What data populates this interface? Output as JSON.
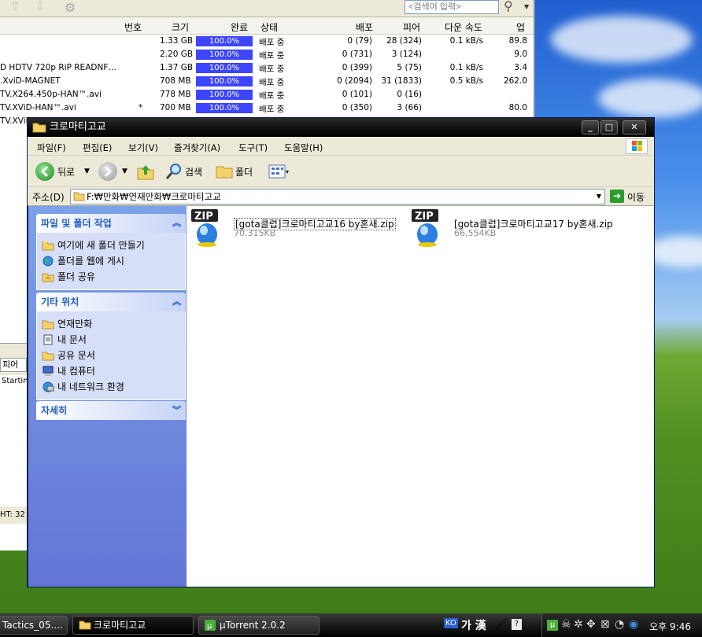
{
  "utorrent": {
    "search_placeholder": "<검색어 입력>",
    "columns": [
      "번호",
      "크기",
      "완료",
      "상태",
      "배포",
      "피어",
      "다운 속도",
      "업"
    ],
    "rows": [
      {
        "name": "",
        "num": "",
        "size": "1.33 GB",
        "done": "100.0%",
        "status": "배포 중",
        "seeds": "0 (79)",
        "peers": "28 (324)",
        "down": "0.1 kB/s",
        "up": "89.8"
      },
      {
        "name": "",
        "num": "",
        "size": "2.20 GB",
        "done": "100.0%",
        "status": "배포 중",
        "seeds": "0 (731)",
        "peers": "3 (124)",
        "down": "",
        "up": "9.0"
      },
      {
        "name": "D HDTV 720p RiP READNF…",
        "num": "",
        "size": "1.37 GB",
        "done": "100.0%",
        "status": "배포 중",
        "seeds": "0 (399)",
        "peers": "5 (75)",
        "down": "0.1 kB/s",
        "up": "3.4"
      },
      {
        "name": ".XviD-MAGNET",
        "num": "",
        "size": "708 MB",
        "done": "100.0%",
        "status": "배포 중",
        "seeds": "0 (2094)",
        "peers": "31 (1833)",
        "down": "0.5 kB/s",
        "up": "262.0"
      },
      {
        "name": "TV.X264.450p-HAN™.avi",
        "num": "",
        "size": "778 MB",
        "done": "100.0%",
        "status": "배포 중",
        "seeds": "0 (101)",
        "peers": "0 (16)",
        "down": "",
        "up": ""
      },
      {
        "name": "TV.XViD-HAN™.avi",
        "num": "*",
        "size": "700 MB",
        "done": "100.0%",
        "status": "배포 중",
        "seeds": "0 (350)",
        "peers": "3 (66)",
        "down": "",
        "up": "80.0"
      },
      {
        "name": "TV.XViD",
        "num": "",
        "size": "",
        "done": "",
        "status": "",
        "seeds": "",
        "peers": "",
        "down": "",
        "up": ""
      }
    ],
    "lower_tab": "피어",
    "log_text": "Startin",
    "status_text": "HT: 32"
  },
  "explorer": {
    "title": "크로마티고교",
    "menu": [
      "파일(F)",
      "편집(E)",
      "보기(V)",
      "즐겨찾기(A)",
      "도구(T)",
      "도움말(H)"
    ],
    "toolbar": {
      "back": "뒤로",
      "search": "검색",
      "folders": "폴더"
    },
    "address": {
      "label": "주소(D)",
      "path": "F:₩만화₩연재만화₩크로마티고교",
      "go": "이동"
    },
    "tasks": {
      "title": "파일 및 폴더 작업",
      "items": [
        "여기에 새 폴더 만들기",
        "폴더를 웹에 게시",
        "폴더 공유"
      ]
    },
    "places": {
      "title": "기타 위치",
      "items": [
        "연재만화",
        "내 문서",
        "공유 문서",
        "내 컴퓨터",
        "내 네트워크 환경"
      ]
    },
    "details": {
      "title": "자세히"
    },
    "files": [
      {
        "name": "[gota클럽]크로마티고교16 by혼새.zip",
        "size": "70,315KB"
      },
      {
        "name": "[gota클럽]크로마티고교17 by혼새.zip",
        "size": "66,554KB"
      }
    ]
  },
  "taskbar": {
    "buttons": [
      "Tactics_05....",
      "크로마티고교",
      "µTorrent 2.0.2"
    ],
    "ime_label": "가 漢",
    "clock": "오후 9:46"
  },
  "colors": {
    "accent": "#215dc6",
    "progress": "#3d45ff"
  }
}
